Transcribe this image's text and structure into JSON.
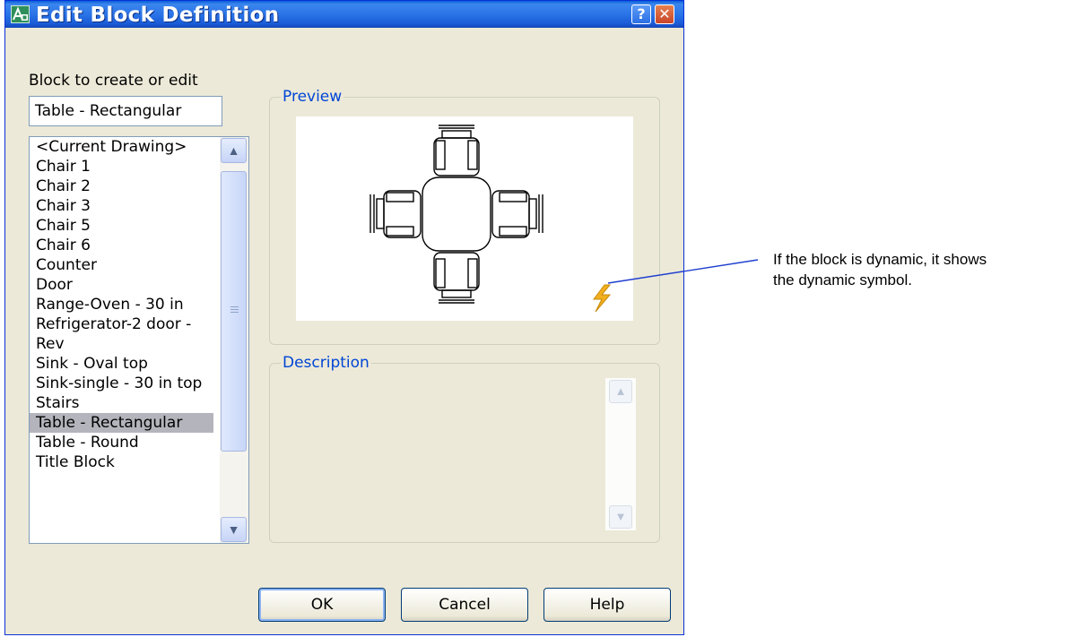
{
  "window": {
    "title": "Edit Block Definition",
    "help_glyph": "?",
    "close_glyph": "✕"
  },
  "block_field": {
    "label": "Block to create or edit",
    "value": "Table - Rectangular"
  },
  "block_list": {
    "items": [
      "<Current Drawing>",
      "Chair 1",
      "Chair 2",
      "Chair 3",
      "Chair 5",
      "Chair 6",
      "Counter",
      "Door",
      "Range-Oven - 30 in",
      "Refrigerator-2 door -",
      "Rev",
      "Sink - Oval top",
      "Sink-single - 30 in top",
      "Stairs",
      "Table - Rectangular",
      "Table - Round",
      "Title Block"
    ],
    "selected": "Table - Rectangular"
  },
  "preview": {
    "legend": "Preview",
    "dynamic_icon": "lightning-bolt-icon"
  },
  "description": {
    "legend": "Description",
    "text": ""
  },
  "buttons": {
    "ok": "OK",
    "cancel": "Cancel",
    "help": "Help"
  },
  "annotation": {
    "line1": "If the block is dynamic, it shows",
    "line2": "the dynamic symbol."
  },
  "colors": {
    "titlebar": "#2a74e8",
    "dialog_bg": "#ece9d8",
    "legend_text": "#0046d5",
    "selection": "#b4b4bc",
    "callout_line": "#1f3fd0",
    "dynamic_symbol": "#f2b01e"
  }
}
